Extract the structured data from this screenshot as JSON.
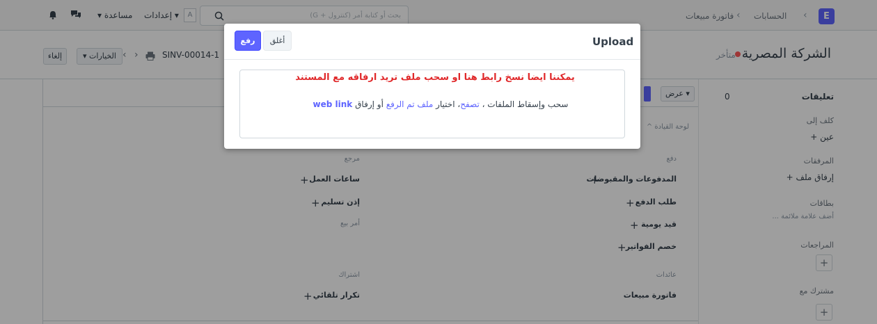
{
  "navbar": {
    "logo_letter": "E",
    "breadcrumb_1": "الحسابات",
    "breadcrumb_2": "فاتورة مبيعات",
    "search_placeholder": "بحث أو كتابة أمر (كنترول + G)",
    "avatar_letter": "A",
    "settings_label": "إعدادات ▾",
    "help_label": "▾ مساعدة"
  },
  "page": {
    "title": "الشركة المصرية",
    "status": "متأخر",
    "doc_name": "SINV-00014-1",
    "options_label": "▾ الخيارات",
    "cancel_label": "إلغاء",
    "view_label": "عرض ▾"
  },
  "sidebar": {
    "comments_label": "تعليقات",
    "comments_count": "0",
    "assigned_label": "كلف إلى",
    "assign_link": "عين +",
    "attachments_label": "المرفقات",
    "attach_link": "إرفاق ملف +",
    "tags_label": "بطاقات",
    "tags_link": "أضف علامة ملائمة ...",
    "reviews_label": "المراجعات",
    "shared_label": "مشترك مع"
  },
  "dashboard": {
    "label": "لوحة القيادة ^",
    "payment_label": "دفع",
    "payment_entries": "المدفوعات والمقبوضات",
    "payment_request": "طلب الدفع",
    "journal_entry": "قيد يومية",
    "invoice_discounting": "خصم الفواتير",
    "returns_label": "عائدات",
    "sales_invoice": "فاتورة مبيعات",
    "reference_label": "مرجع",
    "timesheet": "ساعات العمل",
    "delivery_note": "إذن تسليم",
    "sales_order_label": "أمر بيع",
    "subscription_label": "اشتراك",
    "auto_repeat": "تكرار تلقائي"
  },
  "modal": {
    "title": "Upload",
    "upload_button": "رفع",
    "close_button": "أغلق",
    "note": "يمكننا ايضا نسخ رابط هنا او سحب ملف تريد ارفاقه مع المستند",
    "drop_text": "سحب وإسقاط الملفات ،",
    "browse": "تصفح",
    "sep": "، اختيار",
    "uploaded_file": "ملف تم الرفع",
    "or_attach": "أو إرفاق",
    "web_link": "web link"
  },
  "colors": {
    "primary": "#5e64ff",
    "annotation_red": "#e0282a",
    "status_red": "#ff5858"
  }
}
